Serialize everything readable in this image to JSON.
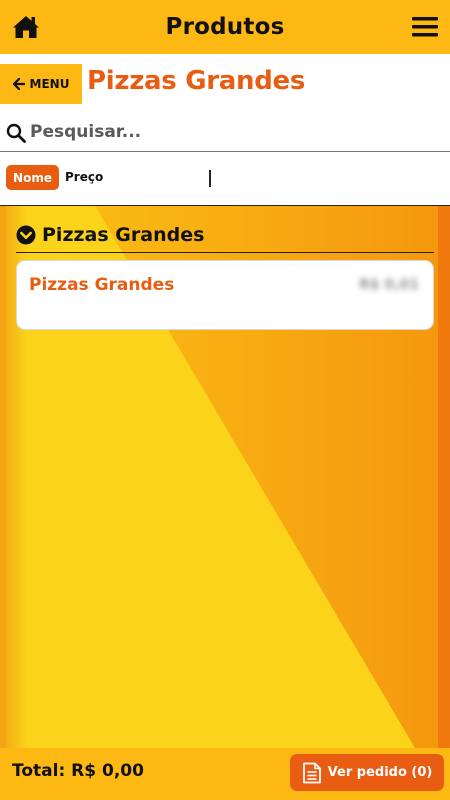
{
  "topbar": {
    "title": "Produtos",
    "home_icon": "home-icon",
    "menu_icon": "hamburger-menu-icon"
  },
  "header": {
    "back_label": "MENU",
    "back_icon": "arrow-left-icon",
    "title": "Pizzas Grandes"
  },
  "search": {
    "placeholder": "Pesquisar...",
    "value": "",
    "icon": "search-icon"
  },
  "sort": {
    "options": [
      "Nome",
      "Preço"
    ],
    "selected": "Nome"
  },
  "section": {
    "title": "Pizzas Grandes",
    "icon": "chevron-down-circle-icon"
  },
  "products": [
    {
      "name": "Pizzas Grandes",
      "price": "R$ 0,01"
    }
  ],
  "footer": {
    "total_label": "Total: R$ 0,00",
    "order_button": "Ver pedido (0)",
    "order_icon": "document-icon"
  },
  "colors": {
    "accent": "#e85d12",
    "bar": "#fdb813",
    "background_yellow": "#fbd31a",
    "background_orange": "#f7a510"
  }
}
